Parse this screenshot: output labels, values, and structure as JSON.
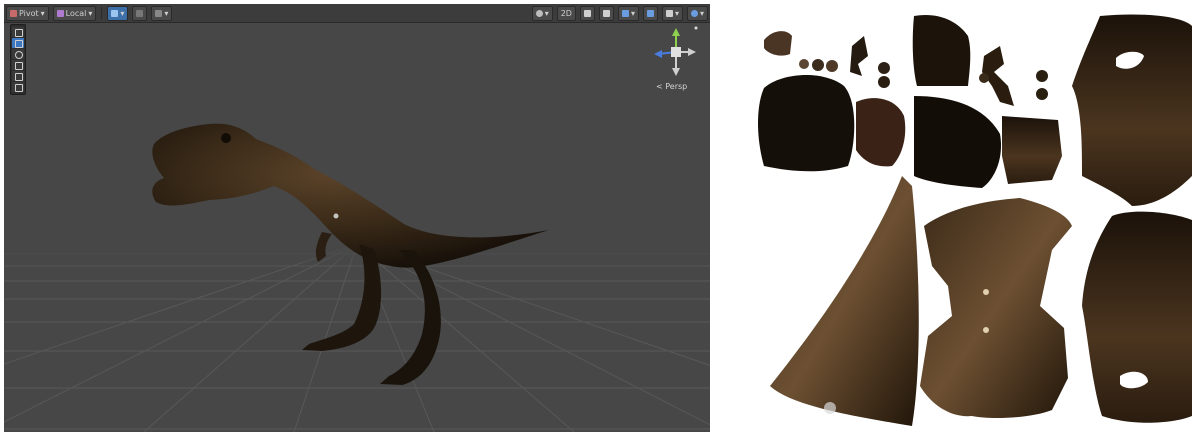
{
  "toolbar": {
    "pivot_label": "Pivot",
    "local_label": "Local",
    "mode_2d_label": "2D"
  },
  "scene": {
    "persp_label": "< Persp"
  },
  "colors": {
    "scene_bg": "#474747",
    "toolbar_bg": "#3c3c3c",
    "accent_blue": "#3d79c2",
    "dino_dark": "#2b2014",
    "texture_bg": "#ffffff"
  },
  "icons": [
    "hand-icon",
    "move-icon",
    "rotate-icon",
    "scale-icon",
    "rect-icon",
    "transform-icon",
    "axis-gizmo-icon"
  ]
}
